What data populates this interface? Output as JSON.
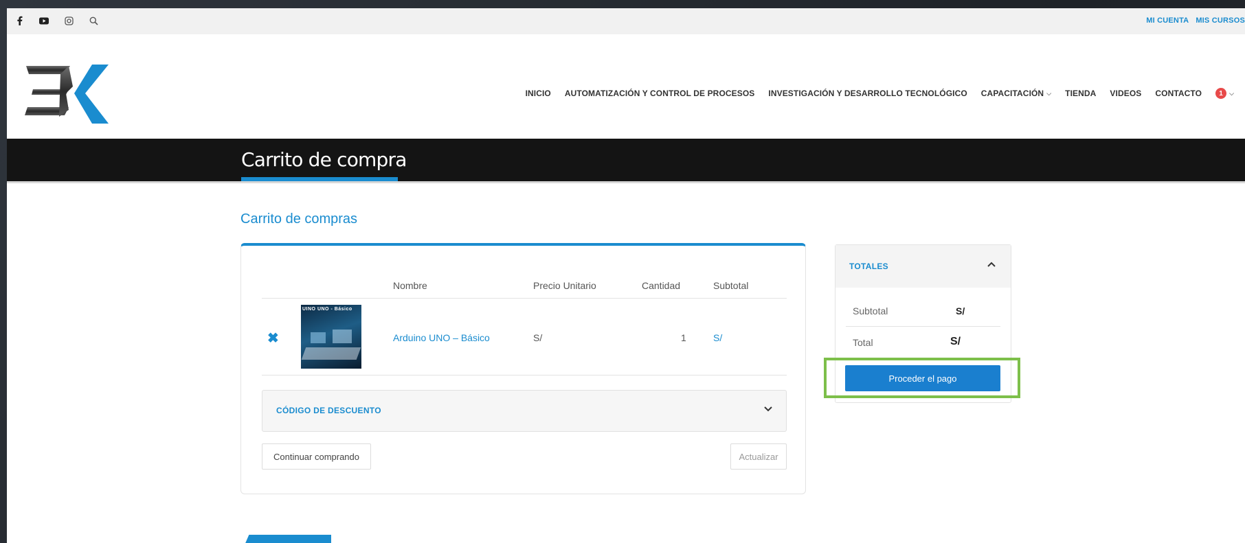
{
  "topbar": {
    "social_icons": [
      "facebook-icon",
      "youtube-icon",
      "instagram-icon",
      "search-icon"
    ],
    "links": [
      "MI CUENTA",
      "MIS CURSOS"
    ]
  },
  "header": {
    "nav": [
      {
        "label": "INICIO"
      },
      {
        "label": "AUTOMATIZACIÓN Y CONTROL DE PROCESOS"
      },
      {
        "label": "INVESTIGACIÓN Y DESARROLLO TECNOLÓGICO"
      },
      {
        "label": "CAPACITACIÓN",
        "dropdown": true
      },
      {
        "label": "TIENDA"
      },
      {
        "label": "VIDEOS"
      },
      {
        "label": "CONTACTO"
      }
    ],
    "cart_count": "1"
  },
  "page_title": "Carrito de compra",
  "cart": {
    "heading": "Carrito de compras",
    "columns": [
      "Nombre",
      "Precio Unitario",
      "Cantidad",
      "Subtotal"
    ],
    "items": [
      {
        "thumb_label": "UINO UNO - Básico",
        "name": "Arduino UNO – Básico",
        "unit_price": "S/",
        "quantity": "1",
        "subtotal": "S/"
      }
    ],
    "discount_label": "CÓDIGO DE DESCUENTO",
    "continue_label": "Continuar comprando",
    "update_label": "Actualizar"
  },
  "totals": {
    "title": "TOTALES",
    "subtotal_label": "Subtotal",
    "subtotal_value": "S/",
    "total_label": "Total",
    "total_value": "S/",
    "checkout_label": "Proceder el pago"
  },
  "colors": {
    "accent": "#1a8ccf",
    "highlight": "#7dbf4a",
    "title_band": "#141414",
    "badge": "#e84a4a"
  }
}
